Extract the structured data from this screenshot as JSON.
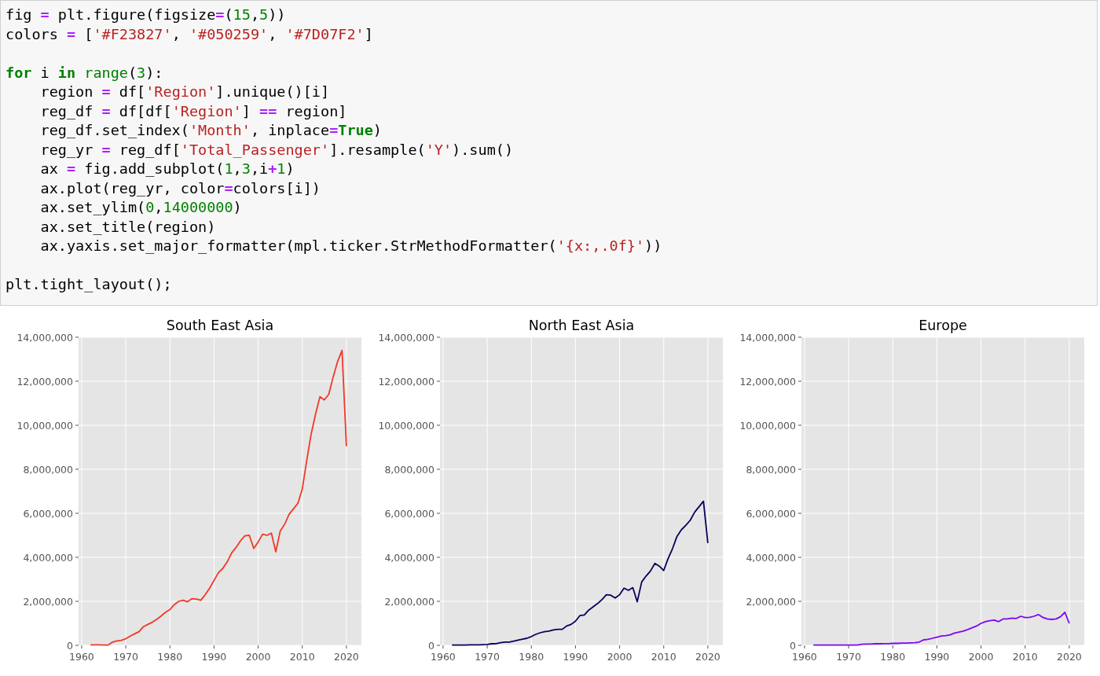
{
  "code_cell": {
    "lines": [
      {
        "tokens": [
          {
            "t": "fig ",
            "kind": "plain"
          },
          {
            "t": "=",
            "kind": "operator"
          },
          {
            "t": " plt.figure(figsize",
            "kind": "plain"
          },
          {
            "t": "=",
            "kind": "operator"
          },
          {
            "t": "(",
            "kind": "plain"
          },
          {
            "t": "15",
            "kind": "number"
          },
          {
            "t": ",",
            "kind": "plain"
          },
          {
            "t": "5",
            "kind": "number"
          },
          {
            "t": "))",
            "kind": "plain"
          }
        ]
      },
      {
        "tokens": [
          {
            "t": "colors ",
            "kind": "plain"
          },
          {
            "t": "=",
            "kind": "operator"
          },
          {
            "t": " [",
            "kind": "plain"
          },
          {
            "t": "'#F23827'",
            "kind": "string"
          },
          {
            "t": ", ",
            "kind": "plain"
          },
          {
            "t": "'#050259'",
            "kind": "string"
          },
          {
            "t": ", ",
            "kind": "plain"
          },
          {
            "t": "'#7D07F2'",
            "kind": "string"
          },
          {
            "t": "]",
            "kind": "plain"
          }
        ]
      },
      {
        "gap_before": true,
        "tokens": [
          {
            "t": "for",
            "kind": "keyword"
          },
          {
            "t": " i ",
            "kind": "plain"
          },
          {
            "t": "in",
            "kind": "keyword"
          },
          {
            "t": " range",
            "kind": "builtin"
          },
          {
            "t": "(",
            "kind": "plain"
          },
          {
            "t": "3",
            "kind": "number"
          },
          {
            "t": "):",
            "kind": "plain"
          }
        ]
      },
      {
        "tokens": [
          {
            "t": "    region ",
            "kind": "plain"
          },
          {
            "t": "=",
            "kind": "operator"
          },
          {
            "t": " df[",
            "kind": "plain"
          },
          {
            "t": "'Region'",
            "kind": "string"
          },
          {
            "t": "].unique()[i]",
            "kind": "plain"
          }
        ]
      },
      {
        "tokens": [
          {
            "t": "    reg_df ",
            "kind": "plain"
          },
          {
            "t": "=",
            "kind": "operator"
          },
          {
            "t": " df[df[",
            "kind": "plain"
          },
          {
            "t": "'Region'",
            "kind": "string"
          },
          {
            "t": "] ",
            "kind": "plain"
          },
          {
            "t": "==",
            "kind": "operator"
          },
          {
            "t": " region]",
            "kind": "plain"
          }
        ]
      },
      {
        "tokens": [
          {
            "t": "    reg_df.set_index(",
            "kind": "plain"
          },
          {
            "t": "'Month'",
            "kind": "string"
          },
          {
            "t": ", inplace",
            "kind": "plain"
          },
          {
            "t": "=",
            "kind": "operator"
          },
          {
            "t": "True",
            "kind": "keyword"
          },
          {
            "t": ")",
            "kind": "plain"
          }
        ]
      },
      {
        "tokens": [
          {
            "t": "    reg_yr ",
            "kind": "plain"
          },
          {
            "t": "=",
            "kind": "operator"
          },
          {
            "t": " reg_df[",
            "kind": "plain"
          },
          {
            "t": "'Total_Passenger'",
            "kind": "string"
          },
          {
            "t": "].resample(",
            "kind": "plain"
          },
          {
            "t": "'Y'",
            "kind": "string"
          },
          {
            "t": ").sum()",
            "kind": "plain"
          }
        ]
      },
      {
        "tokens": [
          {
            "t": "    ax ",
            "kind": "plain"
          },
          {
            "t": "=",
            "kind": "operator"
          },
          {
            "t": " fig.add_subplot(",
            "kind": "plain"
          },
          {
            "t": "1",
            "kind": "number"
          },
          {
            "t": ",",
            "kind": "plain"
          },
          {
            "t": "3",
            "kind": "number"
          },
          {
            "t": ",i",
            "kind": "plain"
          },
          {
            "t": "+",
            "kind": "operator"
          },
          {
            "t": "1",
            "kind": "number"
          },
          {
            "t": ")",
            "kind": "plain"
          }
        ]
      },
      {
        "tokens": [
          {
            "t": "    ax.plot(reg_yr, color",
            "kind": "plain"
          },
          {
            "t": "=",
            "kind": "operator"
          },
          {
            "t": "colors[i])",
            "kind": "plain"
          }
        ]
      },
      {
        "tokens": [
          {
            "t": "    ax.set_ylim(",
            "kind": "plain"
          },
          {
            "t": "0",
            "kind": "number"
          },
          {
            "t": ",",
            "kind": "plain"
          },
          {
            "t": "14000000",
            "kind": "number"
          },
          {
            "t": ")",
            "kind": "plain"
          }
        ]
      },
      {
        "tokens": [
          {
            "t": "    ax.set_title(region)",
            "kind": "plain"
          }
        ]
      },
      {
        "tokens": [
          {
            "t": "    ax.yaxis.set_major_formatter(mpl.ticker.StrMethodFormatter(",
            "kind": "plain"
          },
          {
            "t": "'{x:,.0f}'",
            "kind": "string"
          },
          {
            "t": "))",
            "kind": "plain"
          }
        ]
      },
      {
        "gap_before": true,
        "tokens": [
          {
            "t": "plt.tight_layout();",
            "kind": "plain"
          }
        ]
      }
    ]
  },
  "charts": [
    {
      "chart_data": {
        "type": "line",
        "title": "South East Asia",
        "grid": true,
        "x": [
          1962,
          1963,
          1964,
          1965,
          1966,
          1967,
          1968,
          1969,
          1970,
          1971,
          1972,
          1973,
          1974,
          1975,
          1976,
          1977,
          1978,
          1979,
          1980,
          1981,
          1982,
          1983,
          1984,
          1985,
          1986,
          1987,
          1988,
          1989,
          1990,
          1991,
          1992,
          1993,
          1994,
          1995,
          1996,
          1997,
          1998,
          1999,
          2000,
          2001,
          2002,
          2003,
          2004,
          2005,
          2006,
          2007,
          2008,
          2009,
          2010,
          2011,
          2012,
          2013,
          2014,
          2015,
          2016,
          2017,
          2018,
          2019,
          2020
        ],
        "series": [
          {
            "color": "#f23827",
            "values": [
              20000,
              20000,
              20000,
              10000,
              10000,
              150000,
              200000,
              230000,
              300000,
              420000,
              520000,
              620000,
              850000,
              950000,
              1050000,
              1180000,
              1330000,
              1500000,
              1630000,
              1850000,
              2000000,
              2050000,
              1980000,
              2120000,
              2100000,
              2050000,
              2300000,
              2600000,
              2950000,
              3300000,
              3500000,
              3800000,
              4200000,
              4450000,
              4750000,
              4980000,
              5000000,
              4400000,
              4700000,
              5050000,
              5000000,
              5100000,
              4250000,
              5200000,
              5500000,
              5950000,
              6200000,
              6450000,
              7100000,
              8400000,
              9600000,
              10500000,
              11300000,
              11150000,
              11400000,
              12200000,
              12900000,
              13400000,
              9050000
            ]
          }
        ],
        "xlim": [
          1959.3,
          2023.4
        ],
        "ylim": [
          0,
          14000000
        ],
        "xticks": [
          1960,
          1970,
          1980,
          1990,
          2000,
          2010,
          2020
        ],
        "yticks": [
          {
            "value": 0,
            "label": "0"
          },
          {
            "value": 2000000,
            "label": "2,000,000"
          },
          {
            "value": 4000000,
            "label": "4,000,000"
          },
          {
            "value": 6000000,
            "label": "6,000,000"
          },
          {
            "value": 8000000,
            "label": "8,000,000"
          },
          {
            "value": 10000000,
            "label": "10,000,000"
          },
          {
            "value": 12000000,
            "label": "12,000,000"
          },
          {
            "value": 14000000,
            "label": "14,000,000"
          }
        ]
      }
    },
    {
      "chart_data": {
        "type": "line",
        "title": "North East Asia",
        "grid": true,
        "x": [
          1962,
          1963,
          1964,
          1965,
          1966,
          1967,
          1968,
          1969,
          1970,
          1971,
          1972,
          1973,
          1974,
          1975,
          1976,
          1977,
          1978,
          1979,
          1980,
          1981,
          1982,
          1983,
          1984,
          1985,
          1986,
          1987,
          1988,
          1989,
          1990,
          1991,
          1992,
          1993,
          1994,
          1995,
          1996,
          1997,
          1998,
          1999,
          2000,
          2001,
          2002,
          2003,
          2004,
          2005,
          2006,
          2007,
          2008,
          2009,
          2010,
          2011,
          2012,
          2013,
          2014,
          2015,
          2016,
          2017,
          2018,
          2019,
          2020
        ],
        "series": [
          {
            "color": "#050259",
            "values": [
              10000,
              10000,
              10000,
              10000,
              20000,
              20000,
              20000,
              30000,
              40000,
              70000,
              80000,
              120000,
              150000,
              150000,
              190000,
              240000,
              280000,
              320000,
              400000,
              500000,
              570000,
              620000,
              650000,
              700000,
              730000,
              730000,
              880000,
              950000,
              1100000,
              1350000,
              1380000,
              1600000,
              1750000,
              1900000,
              2080000,
              2300000,
              2280000,
              2150000,
              2300000,
              2600000,
              2500000,
              2620000,
              1980000,
              2880000,
              3150000,
              3380000,
              3720000,
              3600000,
              3400000,
              3950000,
              4400000,
              4950000,
              5250000,
              5450000,
              5680000,
              6050000,
              6300000,
              6550000,
              4650000
            ]
          }
        ],
        "xlim": [
          1959.3,
          2023.4
        ],
        "ylim": [
          0,
          14000000
        ],
        "xticks": [
          1960,
          1970,
          1980,
          1990,
          2000,
          2010,
          2020
        ],
        "yticks": [
          {
            "value": 0,
            "label": "0"
          },
          {
            "value": 2000000,
            "label": "2,000,000"
          },
          {
            "value": 4000000,
            "label": "4,000,000"
          },
          {
            "value": 6000000,
            "label": "6,000,000"
          },
          {
            "value": 8000000,
            "label": "8,000,000"
          },
          {
            "value": 10000000,
            "label": "10,000,000"
          },
          {
            "value": 12000000,
            "label": "12,000,000"
          },
          {
            "value": 14000000,
            "label": "14,000,000"
          }
        ]
      }
    },
    {
      "chart_data": {
        "type": "line",
        "title": "Europe",
        "grid": true,
        "x": [
          1962,
          1963,
          1964,
          1965,
          1966,
          1967,
          1968,
          1969,
          1970,
          1971,
          1972,
          1973,
          1974,
          1975,
          1976,
          1977,
          1978,
          1979,
          1980,
          1981,
          1982,
          1983,
          1984,
          1985,
          1986,
          1987,
          1988,
          1989,
          1990,
          1991,
          1992,
          1993,
          1994,
          1995,
          1996,
          1997,
          1998,
          1999,
          2000,
          2001,
          2002,
          2003,
          2004,
          2005,
          2006,
          2007,
          2008,
          2009,
          2010,
          2011,
          2012,
          2013,
          2014,
          2015,
          2016,
          2017,
          2018,
          2019,
          2020
        ],
        "series": [
          {
            "color": "#7d07f2",
            "values": [
              10000,
              10000,
              10000,
              10000,
              10000,
              10000,
              10000,
              10000,
              10000,
              10000,
              10000,
              50000,
              60000,
              60000,
              70000,
              70000,
              80000,
              80000,
              90000,
              90000,
              100000,
              100000,
              110000,
              120000,
              150000,
              250000,
              270000,
              320000,
              370000,
              420000,
              440000,
              480000,
              560000,
              600000,
              650000,
              720000,
              800000,
              880000,
              1000000,
              1080000,
              1120000,
              1150000,
              1080000,
              1200000,
              1200000,
              1240000,
              1220000,
              1320000,
              1260000,
              1270000,
              1320000,
              1400000,
              1270000,
              1200000,
              1180000,
              1200000,
              1300000,
              1500000,
              1000000
            ]
          }
        ],
        "xlim": [
          1959.3,
          2023.4
        ],
        "ylim": [
          0,
          14000000
        ],
        "xticks": [
          1960,
          1970,
          1980,
          1990,
          2000,
          2010,
          2020
        ],
        "yticks": [
          {
            "value": 0,
            "label": "0"
          },
          {
            "value": 2000000,
            "label": "2,000,000"
          },
          {
            "value": 4000000,
            "label": "4,000,000"
          },
          {
            "value": 6000000,
            "label": "6,000,000"
          },
          {
            "value": 8000000,
            "label": "8,000,000"
          },
          {
            "value": 10000000,
            "label": "10,000,000"
          },
          {
            "value": 12000000,
            "label": "12,000,000"
          },
          {
            "value": 14000000,
            "label": "14,000,000"
          }
        ]
      }
    }
  ]
}
